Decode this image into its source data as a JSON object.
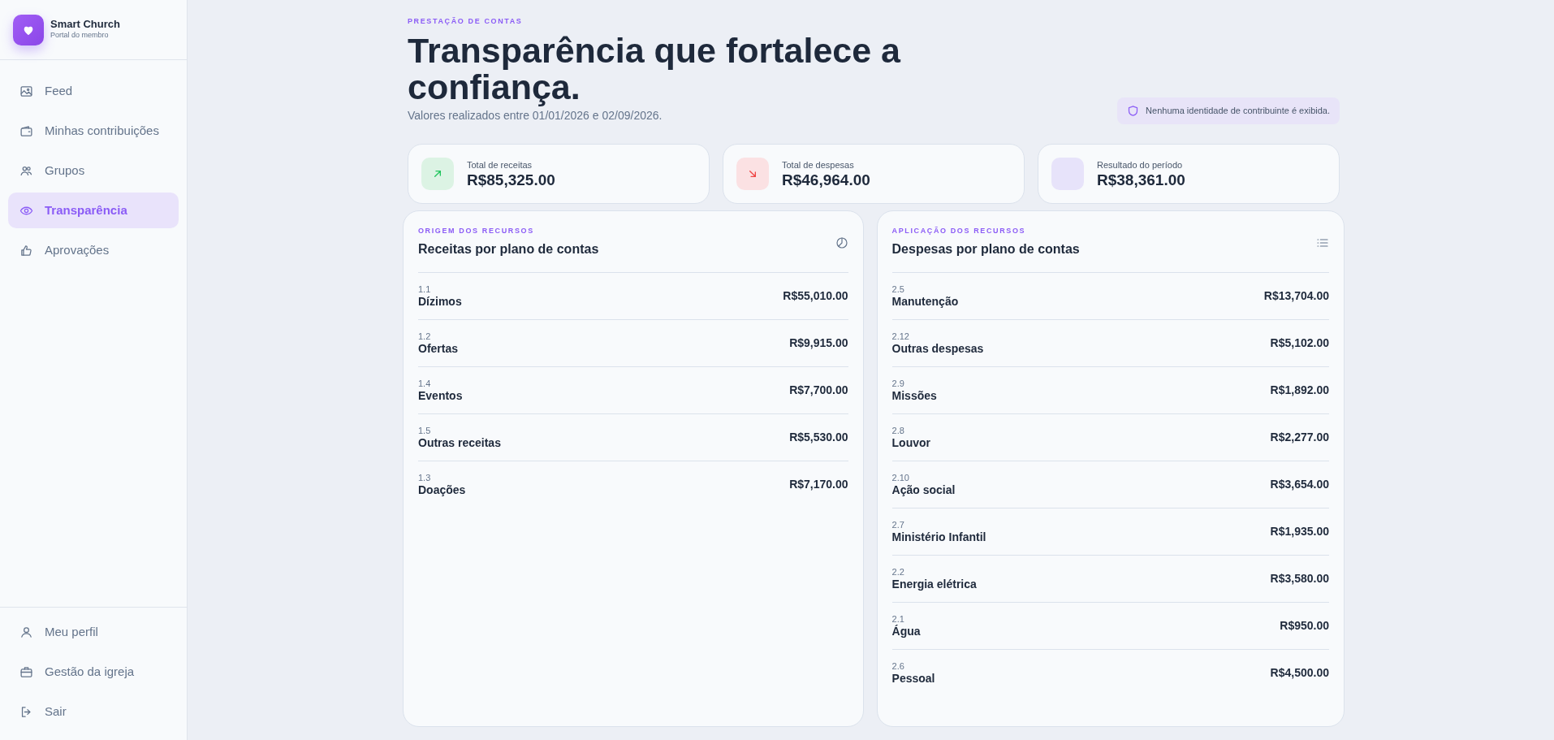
{
  "brand": {
    "name": "Smart Church",
    "subtitle": "Portal do membro"
  },
  "nav": [
    {
      "label": "Feed",
      "selected": false
    },
    {
      "label": "Minhas contribuições",
      "selected": false
    },
    {
      "label": "Grupos",
      "selected": false
    },
    {
      "label": "Transparência",
      "selected": true
    },
    {
      "label": "Aprovações",
      "selected": false
    }
  ],
  "nav_bottom": [
    {
      "label": "Meu perfil"
    },
    {
      "label": "Gestão da igreja"
    },
    {
      "label": "Sair"
    }
  ],
  "header": {
    "eyebrow": "PRESTAÇÃO DE CONTAS",
    "title": "Transparência que fortalece a confiança.",
    "subtitle": "Valores realizados entre 01/01/2026 e 02/09/2026.",
    "privacy_note": "Nenhuma identidade de contribuinte é exibida."
  },
  "stats": [
    {
      "kind": "income",
      "label": "Total de receitas",
      "value": "R$85,325.00"
    },
    {
      "kind": "expense",
      "label": "Total de despesas",
      "value": "R$46,964.00"
    },
    {
      "kind": "result",
      "label": "Resultado do período",
      "value": "R$38,361.00"
    }
  ],
  "panels": [
    {
      "eyebrow": "ORIGEM DOS RECURSOS",
      "title": "Receitas por plano de contas",
      "kind": "chart",
      "rows": [
        {
          "code": "1.1",
          "name": "Dízimos",
          "amount": "R$55,010.00"
        },
        {
          "code": "1.2",
          "name": "Ofertas",
          "amount": "R$9,915.00"
        },
        {
          "code": "1.4",
          "name": "Eventos",
          "amount": "R$7,700.00"
        },
        {
          "code": "1.5",
          "name": "Outras receitas",
          "amount": "R$5,530.00"
        },
        {
          "code": "1.3",
          "name": "Doações",
          "amount": "R$7,170.00"
        }
      ]
    },
    {
      "eyebrow": "APLICAÇÃO DOS RECURSOS",
      "title": "Despesas por plano de contas",
      "kind": "list",
      "rows": [
        {
          "code": "2.5",
          "name": "Manutenção",
          "amount": "R$13,704.00"
        },
        {
          "code": "2.12",
          "name": "Outras despesas",
          "amount": "R$5,102.00"
        },
        {
          "code": "2.9",
          "name": "Missões",
          "amount": "R$1,892.00"
        },
        {
          "code": "2.8",
          "name": "Louvor",
          "amount": "R$2,277.00"
        },
        {
          "code": "2.10",
          "name": "Ação social",
          "amount": "R$3,654.00"
        },
        {
          "code": "2.7",
          "name": "Ministério Infantil",
          "amount": "R$1,935.00"
        },
        {
          "code": "2.2",
          "name": "Energia elétrica",
          "amount": "R$3,580.00"
        },
        {
          "code": "2.1",
          "name": "Água",
          "amount": "R$950.00"
        },
        {
          "code": "2.6",
          "name": "Pessoal",
          "amount": "R$4,500.00"
        }
      ]
    }
  ]
}
